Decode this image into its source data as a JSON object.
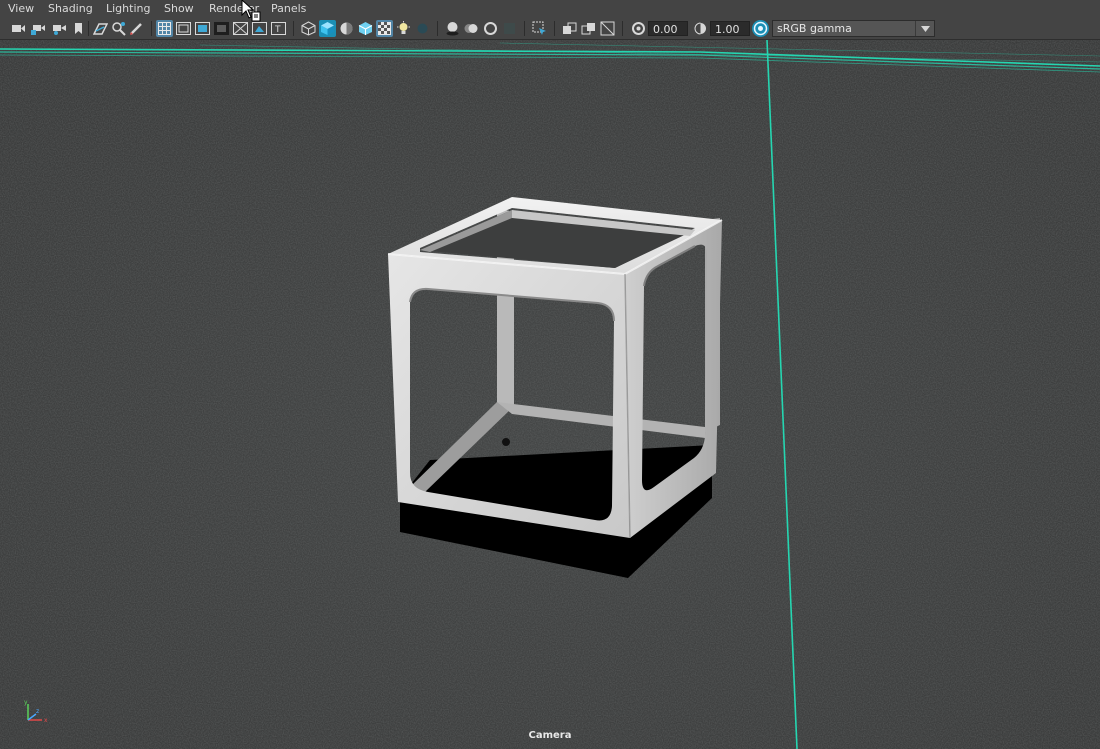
{
  "menubar": {
    "items": [
      "View",
      "Shading",
      "Lighting",
      "Show",
      "Renderer",
      "Panels"
    ]
  },
  "toolbar": {
    "icons": [
      "camera-select-icon",
      "camera-attributes-icon",
      "camera-bookmark-icon",
      "bookmark-icon",
      "image-plane-icon",
      "2d-pan-zoom-icon",
      "grease-pencil-icon",
      "grid-icon",
      "film-gate-icon",
      "resolution-gate-icon",
      "gate-mask-icon",
      "field-chart-icon",
      "safe-action-icon",
      "safe-title-icon",
      "wireframe-icon",
      "smooth-shade-icon",
      "default-material-icon",
      "textured-icon",
      "xray-icon",
      "use-lights-icon",
      "shadows-icon",
      "screen-space-ao-icon",
      "motion-blur-icon",
      "multisample-aa-icon",
      "depth-of-field-icon",
      "isolate-select-icon",
      "xray-joints-icon",
      "xray-active-icon",
      "backface-icon",
      "exposure-reset-icon",
      "gamma-reset-icon",
      "color-management-icon"
    ],
    "exposure_value": "0.00",
    "gamma_value": "1.00",
    "color_space": "sRGB gamma"
  },
  "viewport": {
    "camera_label": "Camera",
    "object": "hollow-cube-frame",
    "background_color": "#3b3c3c",
    "grid_line_color": "#25d6b1"
  },
  "axis": {
    "x": "x",
    "y": "y",
    "z": "z"
  }
}
